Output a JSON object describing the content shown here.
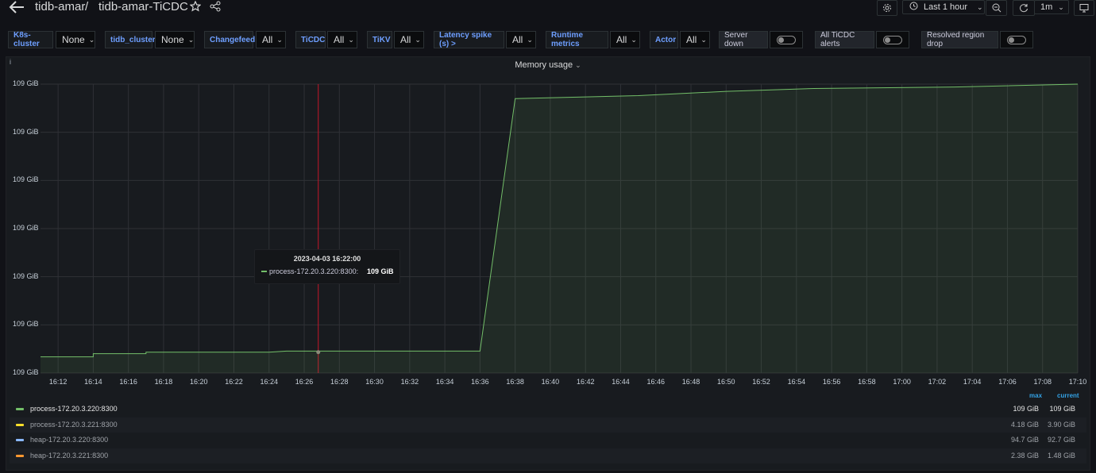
{
  "breadcrumb": {
    "folder": "tidb-amar",
    "separator": "/",
    "dashboard": "tidb-amar-TiCDC"
  },
  "timepicker": {
    "range": "Last 1 hour",
    "refresh": "1m"
  },
  "variables": [
    {
      "label": "K8s-cluster",
      "value": "None"
    },
    {
      "label": "tidb_cluster",
      "value": "None"
    },
    {
      "label": "Changefeed",
      "value": "All"
    },
    {
      "label": "TiCDC",
      "value": "All"
    },
    {
      "label": "TiKV",
      "value": "All"
    },
    {
      "label": "Latency spike (s) >",
      "value": "All"
    },
    {
      "label": "Runtime metrics",
      "value": "All"
    },
    {
      "label": "Actor",
      "value": "All"
    }
  ],
  "toggles": [
    {
      "label": "Server down"
    },
    {
      "label": "All TiCDC alerts"
    },
    {
      "label": "Resolved region drop"
    }
  ],
  "panel": {
    "title": "Memory usage",
    "info_icon": "i"
  },
  "chart_data": {
    "type": "area",
    "title": "Memory usage",
    "y_tick_labels": [
      "109 GiB",
      "109 GiB",
      "109 GiB",
      "109 GiB",
      "109 GiB",
      "109 GiB",
      "109 GiB"
    ],
    "x_tick_labels": [
      "16:12",
      "16:14",
      "16:16",
      "16:18",
      "16:20",
      "16:22",
      "16:24",
      "16:26",
      "16:28",
      "16:30",
      "16:32",
      "16:34",
      "16:36",
      "16:38",
      "16:40",
      "16:42",
      "16:44",
      "16:46",
      "16:48",
      "16:50",
      "16:52",
      "16:54",
      "16:56",
      "16:58",
      "17:00",
      "17:02",
      "17:04",
      "17:06",
      "17:08",
      "17:10"
    ],
    "series": [
      {
        "name": "process-172.20.3.220:8300",
        "color": "#73bf69",
        "x": [
          "16:11",
          "16:14",
          "16:14",
          "16:17",
          "16:17",
          "16:24",
          "16:25",
          "16:36",
          "16:38",
          "16:45",
          "16:50",
          "16:55",
          "17:03",
          "17:10"
        ],
        "values": [
          0.056,
          0.056,
          0.067,
          0.067,
          0.072,
          0.072,
          0.076,
          0.076,
          0.95,
          0.96,
          0.975,
          0.985,
          0.99,
          1.0
        ]
      }
    ],
    "tooltip": {
      "time": "2023-04-03 16:22:00",
      "series": "process-172.20.3.220:8300:",
      "value": "109 GiB"
    }
  },
  "legend": {
    "headers": {
      "max": "max",
      "current": "current"
    },
    "rows": [
      {
        "name": "process-172.20.3.220:8300",
        "color": "#73bf69",
        "max": "109 GiB",
        "current": "109 GiB"
      },
      {
        "name": "process-172.20.3.221:8300",
        "color": "#fade2a",
        "max": "4.18 GiB",
        "current": "3.90 GiB"
      },
      {
        "name": "heap-172.20.3.220:8300",
        "color": "#8ab8ff",
        "max": "94.7 GiB",
        "current": "92.7 GiB"
      },
      {
        "name": "heap-172.20.3.221:8300",
        "color": "#ff9830",
        "max": "2.38 GiB",
        "current": "1.48 GiB"
      }
    ]
  }
}
